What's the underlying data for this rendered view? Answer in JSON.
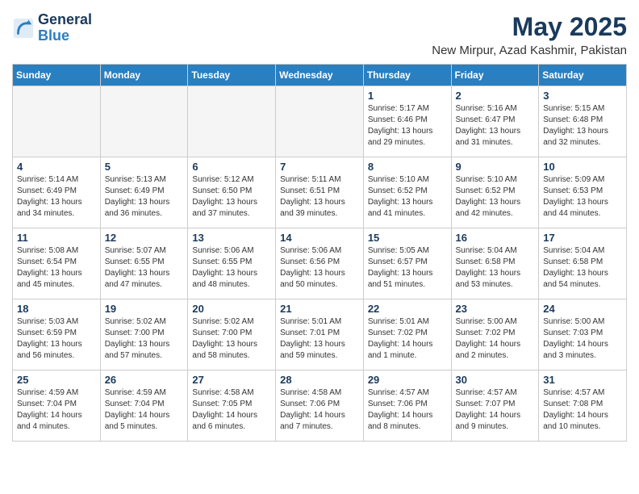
{
  "header": {
    "logo_line1": "General",
    "logo_line2": "Blue",
    "month": "May 2025",
    "location": "New Mirpur, Azad Kashmir, Pakistan"
  },
  "days_of_week": [
    "Sunday",
    "Monday",
    "Tuesday",
    "Wednesday",
    "Thursday",
    "Friday",
    "Saturday"
  ],
  "weeks": [
    [
      {
        "day": "",
        "info": ""
      },
      {
        "day": "",
        "info": ""
      },
      {
        "day": "",
        "info": ""
      },
      {
        "day": "",
        "info": ""
      },
      {
        "day": "1",
        "info": "Sunrise: 5:17 AM\nSunset: 6:46 PM\nDaylight: 13 hours\nand 29 minutes."
      },
      {
        "day": "2",
        "info": "Sunrise: 5:16 AM\nSunset: 6:47 PM\nDaylight: 13 hours\nand 31 minutes."
      },
      {
        "day": "3",
        "info": "Sunrise: 5:15 AM\nSunset: 6:48 PM\nDaylight: 13 hours\nand 32 minutes."
      }
    ],
    [
      {
        "day": "4",
        "info": "Sunrise: 5:14 AM\nSunset: 6:49 PM\nDaylight: 13 hours\nand 34 minutes."
      },
      {
        "day": "5",
        "info": "Sunrise: 5:13 AM\nSunset: 6:49 PM\nDaylight: 13 hours\nand 36 minutes."
      },
      {
        "day": "6",
        "info": "Sunrise: 5:12 AM\nSunset: 6:50 PM\nDaylight: 13 hours\nand 37 minutes."
      },
      {
        "day": "7",
        "info": "Sunrise: 5:11 AM\nSunset: 6:51 PM\nDaylight: 13 hours\nand 39 minutes."
      },
      {
        "day": "8",
        "info": "Sunrise: 5:10 AM\nSunset: 6:52 PM\nDaylight: 13 hours\nand 41 minutes."
      },
      {
        "day": "9",
        "info": "Sunrise: 5:10 AM\nSunset: 6:52 PM\nDaylight: 13 hours\nand 42 minutes."
      },
      {
        "day": "10",
        "info": "Sunrise: 5:09 AM\nSunset: 6:53 PM\nDaylight: 13 hours\nand 44 minutes."
      }
    ],
    [
      {
        "day": "11",
        "info": "Sunrise: 5:08 AM\nSunset: 6:54 PM\nDaylight: 13 hours\nand 45 minutes."
      },
      {
        "day": "12",
        "info": "Sunrise: 5:07 AM\nSunset: 6:55 PM\nDaylight: 13 hours\nand 47 minutes."
      },
      {
        "day": "13",
        "info": "Sunrise: 5:06 AM\nSunset: 6:55 PM\nDaylight: 13 hours\nand 48 minutes."
      },
      {
        "day": "14",
        "info": "Sunrise: 5:06 AM\nSunset: 6:56 PM\nDaylight: 13 hours\nand 50 minutes."
      },
      {
        "day": "15",
        "info": "Sunrise: 5:05 AM\nSunset: 6:57 PM\nDaylight: 13 hours\nand 51 minutes."
      },
      {
        "day": "16",
        "info": "Sunrise: 5:04 AM\nSunset: 6:58 PM\nDaylight: 13 hours\nand 53 minutes."
      },
      {
        "day": "17",
        "info": "Sunrise: 5:04 AM\nSunset: 6:58 PM\nDaylight: 13 hours\nand 54 minutes."
      }
    ],
    [
      {
        "day": "18",
        "info": "Sunrise: 5:03 AM\nSunset: 6:59 PM\nDaylight: 13 hours\nand 56 minutes."
      },
      {
        "day": "19",
        "info": "Sunrise: 5:02 AM\nSunset: 7:00 PM\nDaylight: 13 hours\nand 57 minutes."
      },
      {
        "day": "20",
        "info": "Sunrise: 5:02 AM\nSunset: 7:00 PM\nDaylight: 13 hours\nand 58 minutes."
      },
      {
        "day": "21",
        "info": "Sunrise: 5:01 AM\nSunset: 7:01 PM\nDaylight: 13 hours\nand 59 minutes."
      },
      {
        "day": "22",
        "info": "Sunrise: 5:01 AM\nSunset: 7:02 PM\nDaylight: 14 hours\nand 1 minute."
      },
      {
        "day": "23",
        "info": "Sunrise: 5:00 AM\nSunset: 7:02 PM\nDaylight: 14 hours\nand 2 minutes."
      },
      {
        "day": "24",
        "info": "Sunrise: 5:00 AM\nSunset: 7:03 PM\nDaylight: 14 hours\nand 3 minutes."
      }
    ],
    [
      {
        "day": "25",
        "info": "Sunrise: 4:59 AM\nSunset: 7:04 PM\nDaylight: 14 hours\nand 4 minutes."
      },
      {
        "day": "26",
        "info": "Sunrise: 4:59 AM\nSunset: 7:04 PM\nDaylight: 14 hours\nand 5 minutes."
      },
      {
        "day": "27",
        "info": "Sunrise: 4:58 AM\nSunset: 7:05 PM\nDaylight: 14 hours\nand 6 minutes."
      },
      {
        "day": "28",
        "info": "Sunrise: 4:58 AM\nSunset: 7:06 PM\nDaylight: 14 hours\nand 7 minutes."
      },
      {
        "day": "29",
        "info": "Sunrise: 4:57 AM\nSunset: 7:06 PM\nDaylight: 14 hours\nand 8 minutes."
      },
      {
        "day": "30",
        "info": "Sunrise: 4:57 AM\nSunset: 7:07 PM\nDaylight: 14 hours\nand 9 minutes."
      },
      {
        "day": "31",
        "info": "Sunrise: 4:57 AM\nSunset: 7:08 PM\nDaylight: 14 hours\nand 10 minutes."
      }
    ]
  ]
}
